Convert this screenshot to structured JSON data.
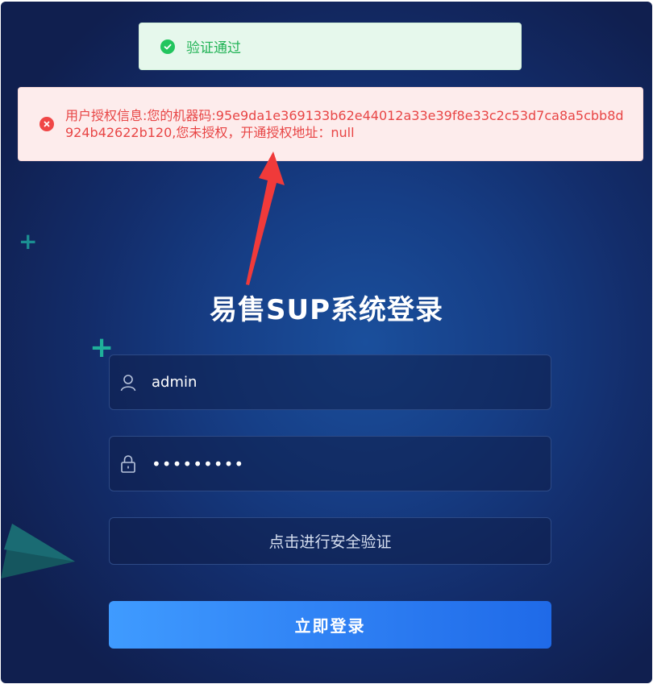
{
  "toasts": {
    "success": {
      "message": "验证通过",
      "icon": "check-circle-icon",
      "color": "#22b356"
    },
    "error": {
      "message": "用户授权信息:您的机器码:95e9da1e369133b62e44012a33e39f8e33c2c53d7ca8a5cbb8d924b42622b120,您未授权，开通授权地址：null",
      "icon": "error-circle-icon",
      "color": "#e84545"
    }
  },
  "login": {
    "title": "易售SUP系统登录",
    "username": {
      "value": "admin",
      "icon": "user-icon"
    },
    "password": {
      "value": "•••••••••",
      "icon": "lock-icon"
    },
    "verify_label": "点击进行安全验证",
    "submit_label": "立即登录"
  },
  "colors": {
    "accent": "#2e7ff3",
    "background": "#163e86",
    "annotation_arrow": "#f03a3a"
  }
}
